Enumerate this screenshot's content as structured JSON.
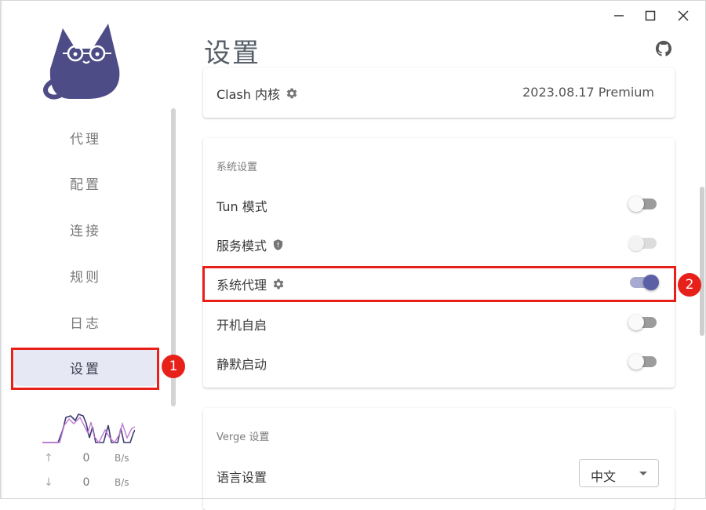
{
  "page_title": "设置",
  "window_controls": [
    "minimize",
    "maximize",
    "close"
  ],
  "sidebar": {
    "items": [
      {
        "label": "代理"
      },
      {
        "label": "配置"
      },
      {
        "label": "连接"
      },
      {
        "label": "规则"
      },
      {
        "label": "日志"
      },
      {
        "label": "设置",
        "active": true
      }
    ],
    "traffic": {
      "upload": {
        "arrow": "↑",
        "value": "0",
        "unit": "B/s"
      },
      "download": {
        "arrow": "↓",
        "value": "0",
        "unit": "B/s"
      }
    }
  },
  "clash_card": {
    "label": "Clash 内核",
    "value": "2023.08.17 Premium"
  },
  "system_card": {
    "header": "系统设置",
    "rows": [
      {
        "label": "Tun 模式",
        "state": "off"
      },
      {
        "label": "服务模式",
        "state": "disabled"
      },
      {
        "label": "系统代理",
        "state": "on"
      },
      {
        "label": "开机自启",
        "state": "off"
      },
      {
        "label": "静默启动",
        "state": "off"
      }
    ]
  },
  "verge_card": {
    "header": "Verge 设置",
    "language_label": "语言设置",
    "language_value": "中文"
  },
  "annotations": {
    "badge_1": "1",
    "badge_2": "2"
  },
  "colors": {
    "accent": "#5b5fa5",
    "accent_track": "#a7a9d0",
    "highlight": "#e8201a",
    "active_nav_bg": "#e6e9f3",
    "logo_body": "#4e4c87"
  }
}
